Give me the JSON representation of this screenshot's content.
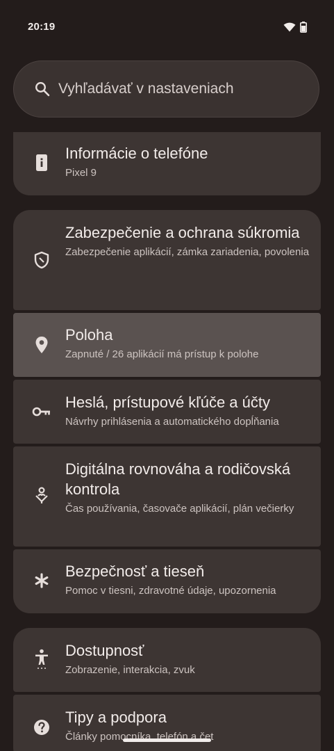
{
  "status_bar": {
    "time": "20:19",
    "icons": [
      "wifi-icon",
      "battery-icon"
    ]
  },
  "search": {
    "placeholder": "Vyhľadávať v nastaveniach",
    "icon": "search-icon"
  },
  "groups": [
    {
      "items": [
        {
          "icon": "phone-info-icon",
          "title": "Informácie o telefóne",
          "subtitle": "Pixel 9"
        }
      ]
    },
    {
      "items": [
        {
          "icon": "shield-icon",
          "title": "Zabezpečenie a ochrana súkromia",
          "subtitle": "Zabezpečenie aplikácií, zámka zariadenia, povolenia"
        },
        {
          "icon": "location-pin-icon",
          "title": "Poloha",
          "subtitle": "Zapnuté / 26 aplikácií má prístup k polohe",
          "active": true
        },
        {
          "icon": "key-icon",
          "title": "Heslá, prístupové kľúče a účty",
          "subtitle": "Návrhy prihlásenia a automatického dopĺňania"
        },
        {
          "icon": "digital-wellbeing-icon",
          "title": "Digitálna rovnováha a rodičovská kontrola",
          "subtitle": "Čas používania, časovače aplikácií, plán večierky"
        },
        {
          "icon": "asterisk-icon",
          "title": "Bezpečnosť a tieseň",
          "subtitle": "Pomoc v tiesni, zdravotné údaje, upozornenia"
        }
      ]
    },
    {
      "items": [
        {
          "icon": "accessibility-icon",
          "title": "Dostupnosť",
          "subtitle": "Zobrazenie, interakcia, zvuk"
        },
        {
          "icon": "help-icon",
          "title": "Tipy a podpora",
          "subtitle": "Články pomocníka, telefón a čet"
        }
      ]
    }
  ],
  "colors": {
    "background": "#231c1b",
    "card": "#3d3533",
    "card_active": "#5a5250",
    "text_primary": "#f2ecea",
    "text_secondary": "#cdc4c1"
  }
}
